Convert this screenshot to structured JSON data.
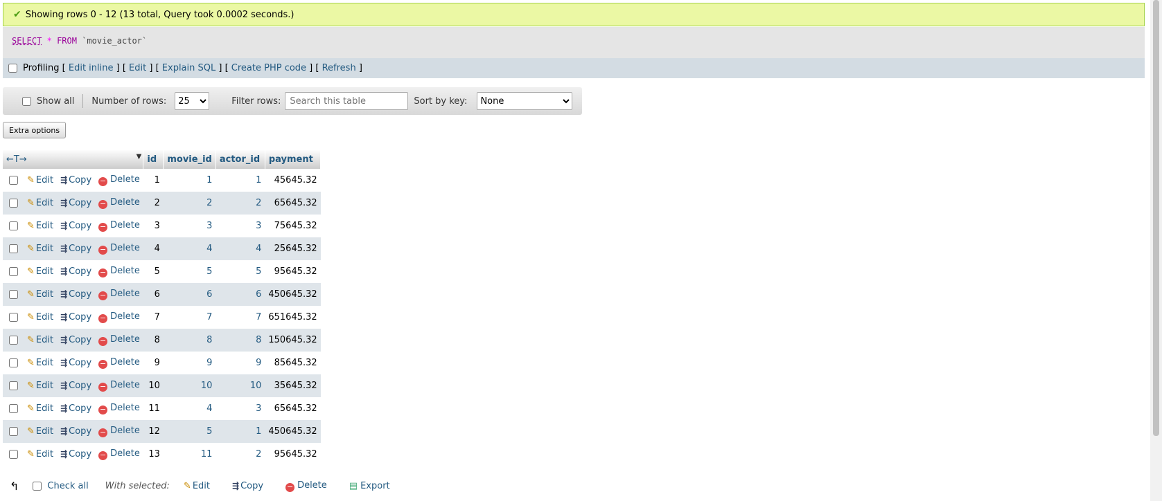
{
  "message": "Showing rows 0 - 12 (13 total, Query took 0.0002 seconds.)",
  "sql": {
    "select": "SELECT",
    "star": "*",
    "from": "FROM",
    "table": "`movie_actor`"
  },
  "profiling": {
    "label": "Profiling",
    "links": [
      "Edit inline",
      "Edit",
      "Explain SQL",
      "Create PHP code",
      "Refresh"
    ]
  },
  "navbar": {
    "show_all": "Show all",
    "num_rows_label": "Number of rows:",
    "num_rows_value": "25",
    "filter_label": "Filter rows:",
    "filter_placeholder": "Search this table",
    "sort_label": "Sort by key:",
    "sort_value": "None"
  },
  "extra_options": "Extra options",
  "table": {
    "arrows": "←T→",
    "columns": [
      "id",
      "movie_id",
      "actor_id",
      "payment"
    ],
    "actions": {
      "edit": "Edit",
      "copy": "Copy",
      "delete": "Delete"
    },
    "rows": [
      {
        "id": "1",
        "movie_id": "1",
        "actor_id": "1",
        "payment": "45645.32"
      },
      {
        "id": "2",
        "movie_id": "2",
        "actor_id": "2",
        "payment": "65645.32"
      },
      {
        "id": "3",
        "movie_id": "3",
        "actor_id": "3",
        "payment": "75645.32"
      },
      {
        "id": "4",
        "movie_id": "4",
        "actor_id": "4",
        "payment": "25645.32"
      },
      {
        "id": "5",
        "movie_id": "5",
        "actor_id": "5",
        "payment": "95645.32"
      },
      {
        "id": "6",
        "movie_id": "6",
        "actor_id": "6",
        "payment": "450645.32"
      },
      {
        "id": "7",
        "movie_id": "7",
        "actor_id": "7",
        "payment": "651645.32"
      },
      {
        "id": "8",
        "movie_id": "8",
        "actor_id": "8",
        "payment": "150645.32"
      },
      {
        "id": "9",
        "movie_id": "9",
        "actor_id": "9",
        "payment": "85645.32"
      },
      {
        "id": "10",
        "movie_id": "10",
        "actor_id": "10",
        "payment": "35645.32"
      },
      {
        "id": "11",
        "movie_id": "4",
        "actor_id": "3",
        "payment": "65645.32"
      },
      {
        "id": "12",
        "movie_id": "5",
        "actor_id": "1",
        "payment": "450645.32"
      },
      {
        "id": "13",
        "movie_id": "11",
        "actor_id": "2",
        "payment": "95645.32"
      }
    ]
  },
  "footer": {
    "check_all": "Check all",
    "with_selected": "With selected:",
    "edit": "Edit",
    "copy": "Copy",
    "delete": "Delete",
    "export": "Export"
  }
}
